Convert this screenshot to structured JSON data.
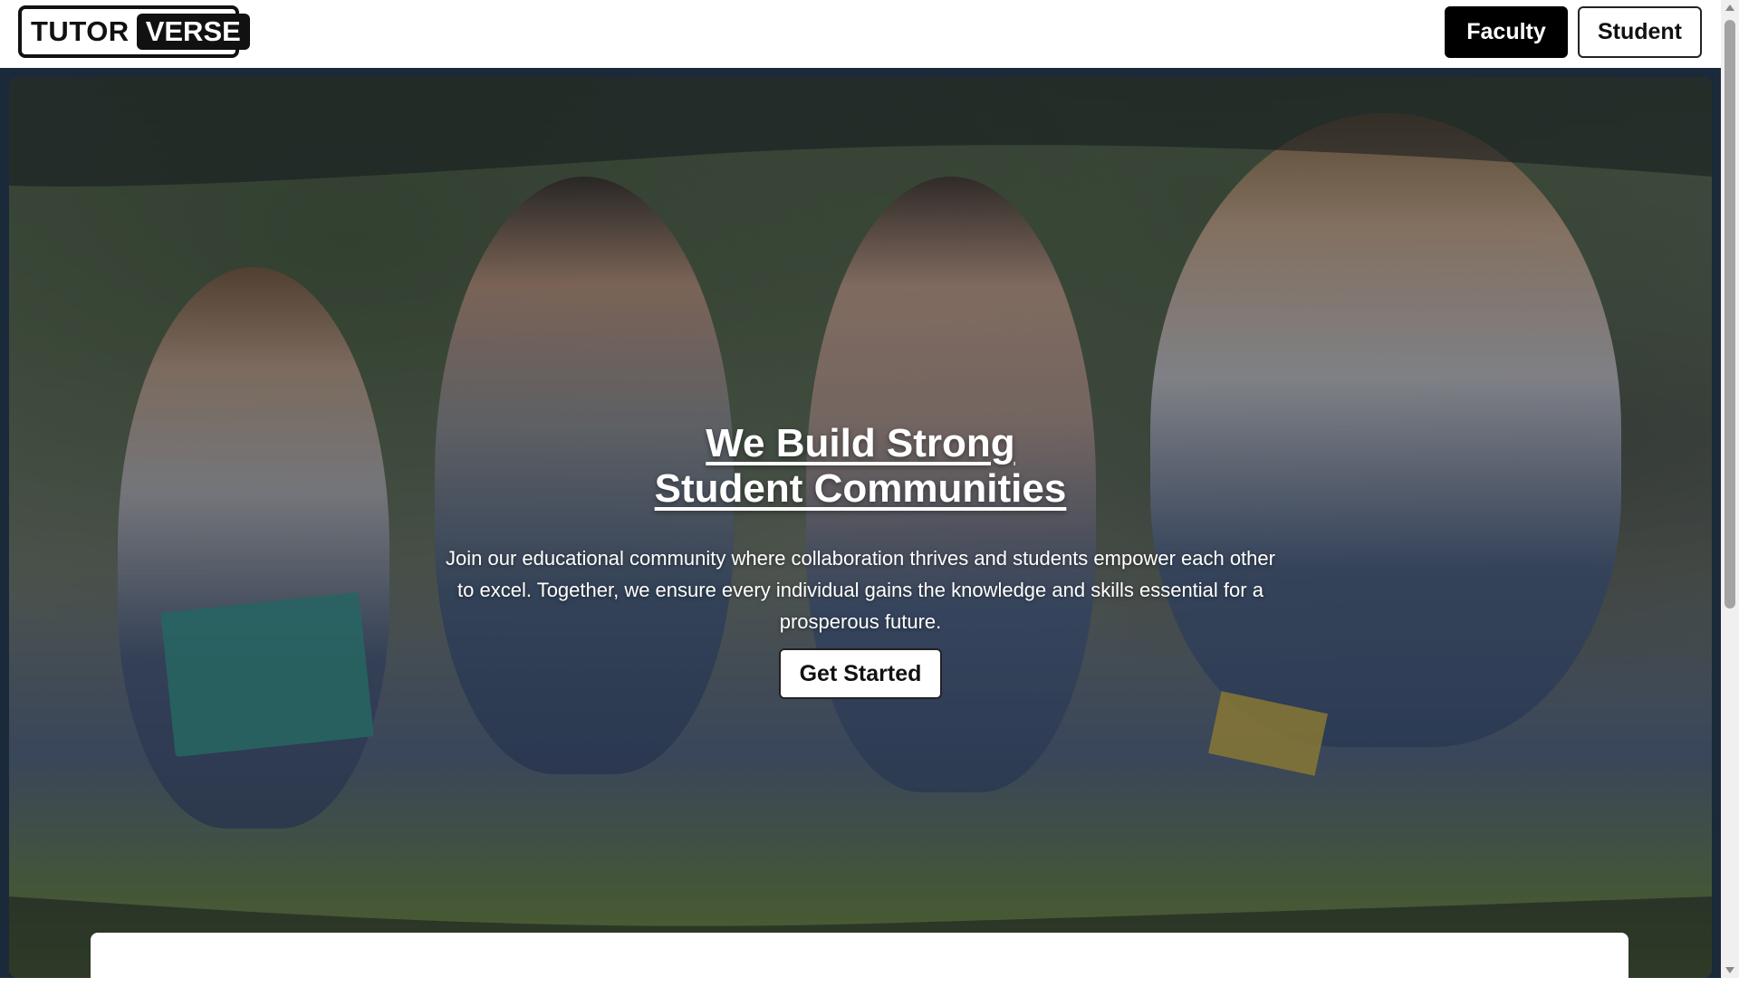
{
  "header": {
    "logo_part1": "TUTOR",
    "logo_part2": "VERSE",
    "nav": {
      "faculty_label": "Faculty",
      "student_label": "Student"
    }
  },
  "hero": {
    "title_line1": "We Build Strong",
    "title_line2": "Student Communities",
    "description": "Join our educational community where collaboration thrives and students empower each other to excel. Together, we ensure every individual gains the knowledge and skills essential for a prosperous future.",
    "cta_label": "Get Started"
  },
  "colors": {
    "primary": "#000000",
    "background": "#ffffff",
    "hero_frame": "#1b2a3a"
  }
}
